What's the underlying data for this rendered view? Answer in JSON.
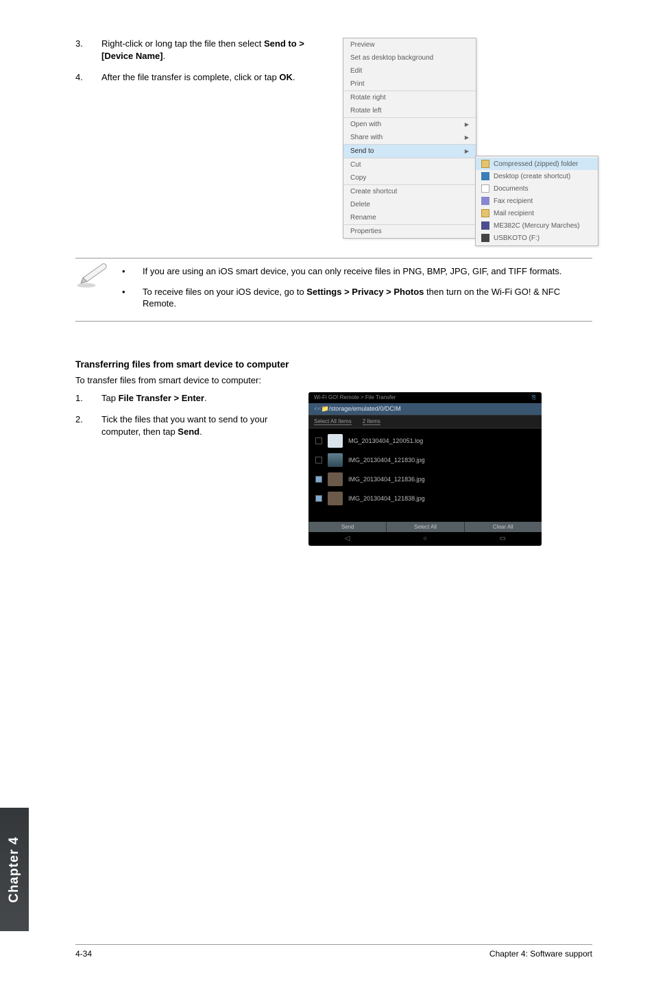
{
  "steps_top": [
    {
      "num": "3.",
      "pre": "Right-click or long tap the file then select ",
      "bold": "Send to > [Device Name]",
      "post": "."
    },
    {
      "num": "4.",
      "pre": "After the file transfer is complete, click or tap ",
      "bold": "OK",
      "post": "."
    }
  ],
  "context_menu": {
    "g1": [
      "Preview",
      "Set as desktop background",
      "Edit",
      "Print"
    ],
    "g2": [
      "Rotate right",
      "Rotate left"
    ],
    "g3": [
      "Open with",
      "Share with"
    ],
    "sendto_label": "Send to",
    "g4": [
      "Cut",
      "Copy"
    ],
    "g5": [
      "Create shortcut",
      "Delete",
      "Rename"
    ],
    "g6": [
      "Properties"
    ]
  },
  "submenu": [
    {
      "icon": "fld",
      "label": "Compressed (zipped) folder",
      "hl": true
    },
    {
      "icon": "desk",
      "label": "Desktop (create shortcut)"
    },
    {
      "icon": "doc",
      "label": "Documents"
    },
    {
      "icon": "fax",
      "label": "Fax recipient"
    },
    {
      "icon": "mail",
      "label": "Mail recipient"
    },
    {
      "icon": "dev",
      "label": "ME382C (Mercury Marches)"
    },
    {
      "icon": "usb",
      "label": "USBKOTO (F:)"
    }
  ],
  "note_bullets": [
    {
      "pre": "If you are using an iOS smart device, you can only receive files in PNG, BMP, JPG, GIF, and TIFF formats.",
      "bold": "",
      "post": ""
    },
    {
      "pre": "To receive files on your iOS device, go to ",
      "bold": "Settings > Privacy > Photos",
      "post": " then turn on the Wi-Fi GO! & NFC Remote."
    }
  ],
  "section2": {
    "heading": "Transferring files from smart device to computer",
    "intro": "To transfer files from smart device to computer:",
    "steps": [
      {
        "num": "1.",
        "pre": "Tap ",
        "bold": "File Transfer > Enter",
        "post": "."
      },
      {
        "num": "2.",
        "pre": "Tick the files that you want to send to your computer, then tap ",
        "bold": "Send",
        "post": "."
      }
    ]
  },
  "mobile": {
    "top_left": "Wi-Fi GO! Remote > File Transfer",
    "top_right": "",
    "crumb_prefix": "<<",
    "crumb_icon": "↙",
    "crumb_text": "/storage/emulated/0/DCIM",
    "bar_left": "Select All Items",
    "bar_right": "2 Items",
    "files": [
      {
        "chk": false,
        "thumb": "docico",
        "name": "MG_20130404_120051.log"
      },
      {
        "chk": false,
        "thumb": "folder",
        "name": "IMG_20130404_121830.jpg"
      },
      {
        "chk": true,
        "thumb": "img",
        "name": "IMG_20130404_121836.jpg"
      },
      {
        "chk": true,
        "thumb": "img",
        "name": "IMG_20130404_121838.jpg"
      }
    ],
    "footer_btns": [
      "Send",
      "Select All",
      "Clear All"
    ]
  },
  "footer": {
    "page": "4-34",
    "chapter": "Chapter 4: Software support"
  },
  "sidetab": "Chapter 4"
}
